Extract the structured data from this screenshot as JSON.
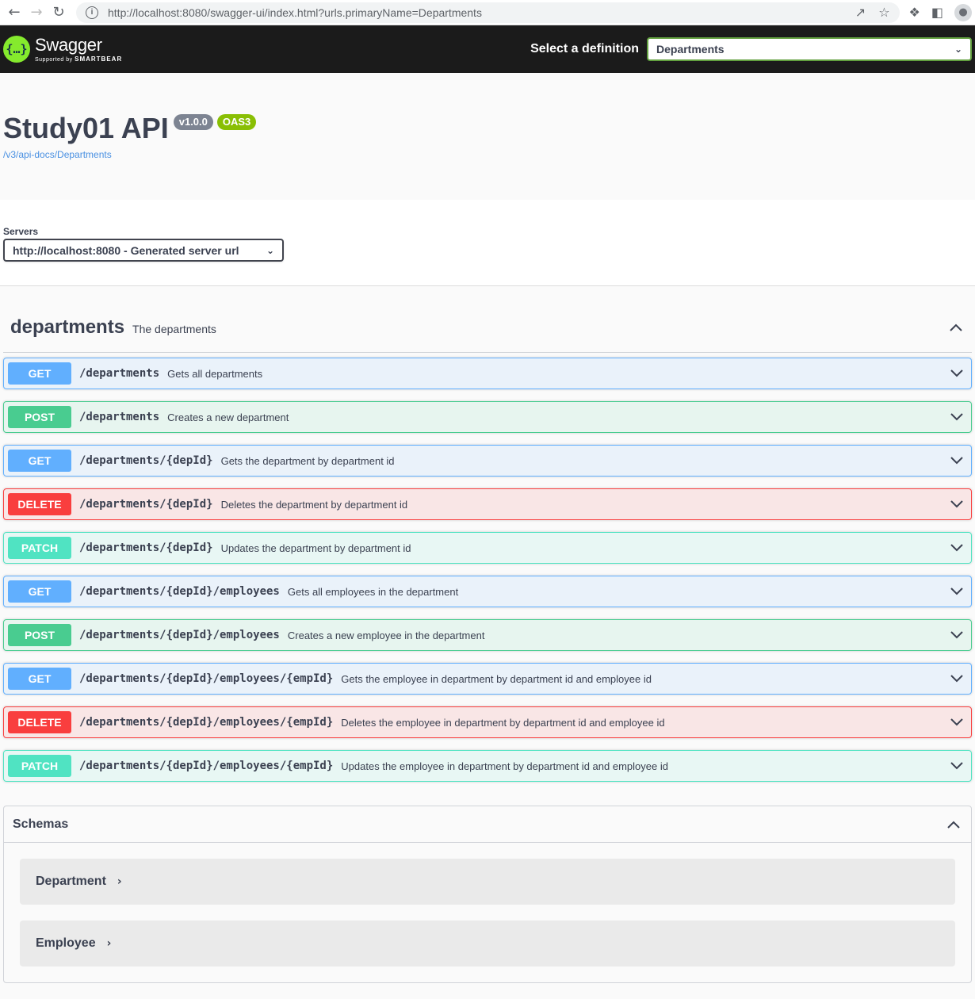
{
  "browser": {
    "url": "http://localhost:8080/swagger-ui/index.html?urls.primaryName=Departments"
  },
  "topbar": {
    "logo_title": "Swagger",
    "logo_supported": "Supported by",
    "logo_brand": "SMARTBEAR",
    "definition_label": "Select a definition",
    "definition_value": "Departments"
  },
  "info": {
    "title": "Study01 API",
    "version": "v1.0.0",
    "oas": "OAS3",
    "url": "/v3/api-docs/Departments"
  },
  "servers": {
    "label": "Servers",
    "selected": "http://localhost:8080 - Generated server url"
  },
  "tag": {
    "name": "departments",
    "description": "The departments"
  },
  "operations": [
    {
      "method": "GET",
      "path": "/departments",
      "summary": "Gets all departments"
    },
    {
      "method": "POST",
      "path": "/departments",
      "summary": "Creates a new department"
    },
    {
      "method": "GET",
      "path": "/departments/{depId}",
      "summary": "Gets the department by department id"
    },
    {
      "method": "DELETE",
      "path": "/departments/{depId}",
      "summary": "Deletes the department by department id"
    },
    {
      "method": "PATCH",
      "path": "/departments/{depId}",
      "summary": "Updates the department by department id"
    },
    {
      "method": "GET",
      "path": "/departments/{depId}/employees",
      "summary": "Gets all employees in the department"
    },
    {
      "method": "POST",
      "path": "/departments/{depId}/employees",
      "summary": "Creates a new employee in the department"
    },
    {
      "method": "GET",
      "path": "/departments/{depId}/employees/{empId}",
      "summary": "Gets the employee in department by department id and employee id"
    },
    {
      "method": "DELETE",
      "path": "/departments/{depId}/employees/{empId}",
      "summary": "Deletes the employee in department by department id and employee id"
    },
    {
      "method": "PATCH",
      "path": "/departments/{depId}/employees/{empId}",
      "summary": "Updates the employee in department by department id and employee id"
    }
  ],
  "schemas": {
    "title": "Schemas",
    "models": [
      "Department",
      "Employee"
    ]
  },
  "colors": {
    "get": "#61affe",
    "post": "#49cc90",
    "delete": "#f93e3e",
    "patch": "#50e3c2",
    "topbar": "#1b1b1b",
    "logo": "#85ea2d"
  }
}
